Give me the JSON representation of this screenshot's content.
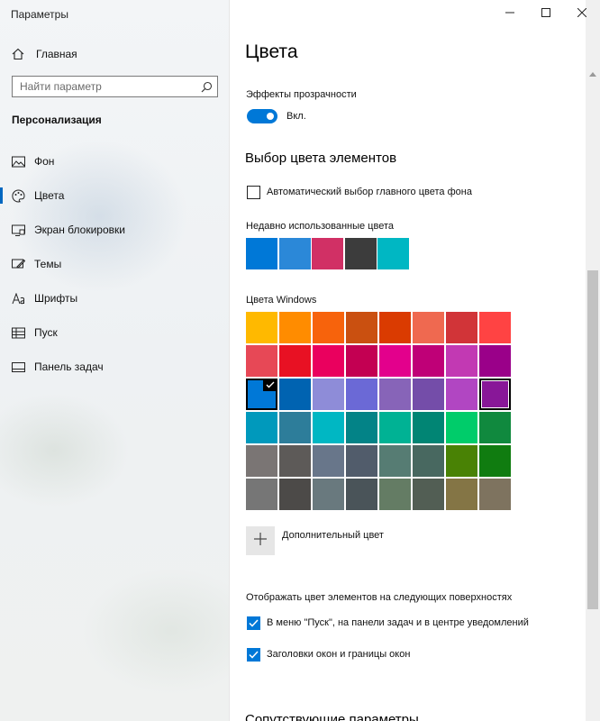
{
  "window": {
    "title": "Параметры",
    "controls": [
      "minimize-icon",
      "maximize-icon",
      "close-icon"
    ]
  },
  "sidebar": {
    "home_label": "Главная",
    "search_placeholder": "Найти параметр",
    "section_title": "Персонализация",
    "items": [
      {
        "label": "Фон",
        "icon": "image-icon",
        "active": false
      },
      {
        "label": "Цвета",
        "icon": "palette-icon",
        "active": true
      },
      {
        "label": "Экран блокировки",
        "icon": "lock-screen-icon",
        "active": false
      },
      {
        "label": "Темы",
        "icon": "themes-icon",
        "active": false
      },
      {
        "label": "Шрифты",
        "icon": "fonts-icon",
        "active": false
      },
      {
        "label": "Пуск",
        "icon": "start-icon",
        "active": false
      },
      {
        "label": "Панель задач",
        "icon": "taskbar-icon",
        "active": false
      }
    ]
  },
  "main": {
    "title": "Цвета",
    "transparency": {
      "label": "Эффекты прозрачности",
      "state_label": "Вкл.",
      "on": true
    },
    "accent_heading": "Выбор цвета элементов",
    "auto_accent": {
      "label": "Автоматический выбор главного цвета фона",
      "checked": false
    },
    "recent_label": "Недавно использованные цвета",
    "recent_colors": [
      "#0078d7",
      "#2b88d8",
      "#d13065",
      "#3c3c3c",
      "#00b7c3"
    ],
    "windows_colors_label": "Цвета Windows",
    "windows_colors": [
      "#ffb900",
      "#ff8c00",
      "#f7630c",
      "#ca5010",
      "#da3b01",
      "#ef6950",
      "#d13438",
      "#ff4343",
      "#e74856",
      "#e81123",
      "#ea005e",
      "#c30052",
      "#e3008c",
      "#bf0077",
      "#c239b3",
      "#9a0089",
      "#0078d7",
      "#0063b1",
      "#8e8cd8",
      "#6b69d6",
      "#8764b8",
      "#744da9",
      "#b146c2",
      "#881798",
      "#0099bc",
      "#2d7d9a",
      "#00b7c3",
      "#038387",
      "#00b294",
      "#018574",
      "#00cc6a",
      "#10893e",
      "#7a7574",
      "#5d5a58",
      "#68768a",
      "#515c6b",
      "#567c73",
      "#486860",
      "#498205",
      "#107c10",
      "#767676",
      "#4c4a48",
      "#69797e",
      "#4a5459",
      "#647c64",
      "#525e54",
      "#847545",
      "#7e735f"
    ],
    "selected_color_index": 16,
    "current_color_index": 23,
    "custom_color_label": "Дополнительный цвет",
    "surfaces_label": "Отображать цвет элементов на следующих поверхностях",
    "surface_start": {
      "label": "В меню \"Пуск\", на панели задач и в центре уведомлений",
      "checked": true
    },
    "surface_titlebars": {
      "label": "Заголовки окон и границы окон",
      "checked": true
    },
    "next_heading": "Сопутствующие параметры"
  },
  "colors": {
    "accent": "#0078d7",
    "sidebar_bg": "#f2f4f6",
    "swatch_add_bg": "#e6e6e6"
  }
}
